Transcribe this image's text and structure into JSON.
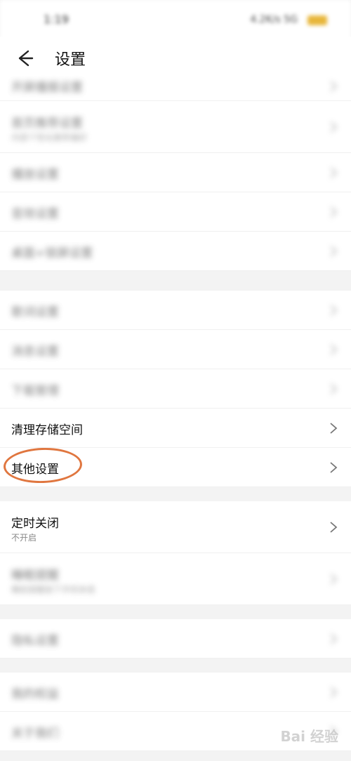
{
  "status_bar": {
    "time": "1:19",
    "indicators": "4.2K/s 5G"
  },
  "header": {
    "title": "设置",
    "back_icon": "arrow-left-icon"
  },
  "groups": [
    {
      "items": [
        {
          "title": "开屏播报设置",
          "blurred": true,
          "partial": true
        },
        {
          "title": "首页推荐设置",
          "sub": "内容个性化推荐偏好",
          "blurred": true
        },
        {
          "title": "播放设置",
          "blurred": true
        },
        {
          "title": "音效设置",
          "blurred": true
        },
        {
          "title": "桌面+锁屏设置",
          "blurred": true
        }
      ]
    },
    {
      "items": [
        {
          "title": "歌词设置",
          "blurred": true
        },
        {
          "title": "消息设置",
          "blurred": true
        },
        {
          "title": "下载管理",
          "blurred": true
        },
        {
          "title": "清理存储空间",
          "blurred": false
        },
        {
          "title": "其他设置",
          "blurred": false,
          "highlighted": true
        }
      ]
    },
    {
      "items": [
        {
          "title": "定时关闭",
          "sub": "不开启",
          "blurred": false
        },
        {
          "title": "睡眠提醒",
          "sub": "睡前提醒放下手机休息",
          "blurred": true
        }
      ]
    },
    {
      "items": [
        {
          "title": "隐私设置",
          "blurred": true
        }
      ]
    },
    {
      "items": [
        {
          "title": "我的权益",
          "blurred": true
        },
        {
          "title": "关于我们",
          "blurred": true
        }
      ]
    }
  ],
  "watermark": "Bai 经验",
  "colors": {
    "highlight_ring": "#e0763f",
    "background": "#f3f3f3",
    "card": "#ffffff"
  }
}
